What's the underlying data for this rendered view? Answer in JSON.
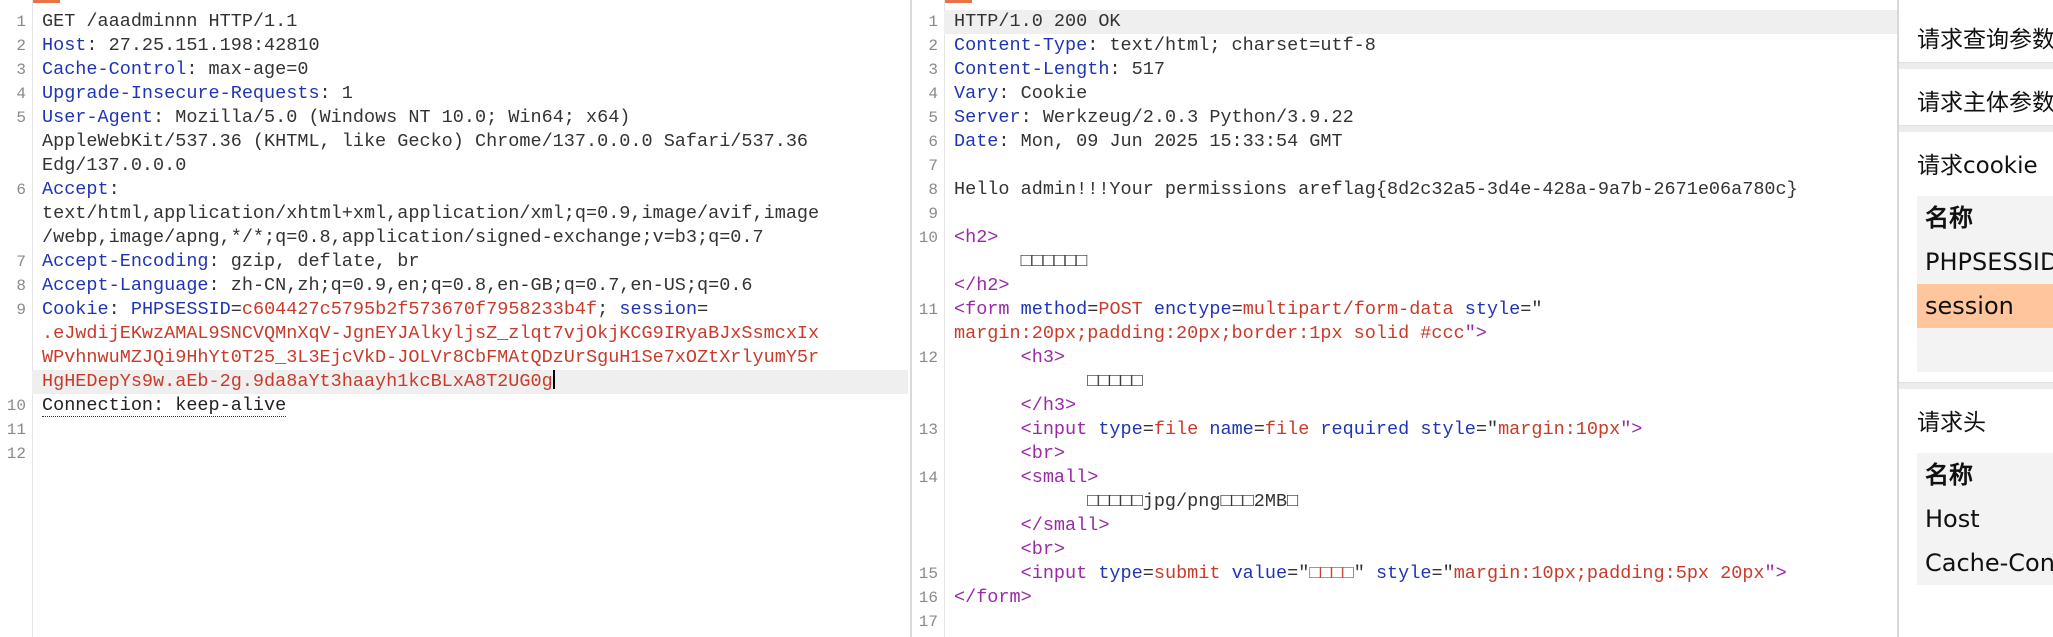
{
  "request": {
    "lines": [
      {
        "n": "1",
        "segs": [
          {
            "t": "GET /aaadminnn HTTP/1.1",
            "c": "v"
          }
        ]
      },
      {
        "n": "2",
        "segs": [
          {
            "t": "Host",
            "c": "k"
          },
          {
            "t": ": 27.25.151.198:42810",
            "c": "v"
          }
        ]
      },
      {
        "n": "3",
        "segs": [
          {
            "t": "Cache-Control",
            "c": "k"
          },
          {
            "t": ": max-age=0",
            "c": "v"
          }
        ]
      },
      {
        "n": "4",
        "segs": [
          {
            "t": "Upgrade-Insecure-Requests",
            "c": "k"
          },
          {
            "t": ": 1",
            "c": "v"
          }
        ]
      },
      {
        "n": "5",
        "segs": [
          {
            "t": "User-Agent",
            "c": "k"
          },
          {
            "t": ": Mozilla/5.0 (Windows NT 10.0; Win64; x64)",
            "c": "v"
          }
        ]
      },
      {
        "n": "",
        "segs": [
          {
            "t": "AppleWebKit/537.36 (KHTML, like Gecko) Chrome/137.0.0.0 Safari/537.36",
            "c": "v"
          }
        ]
      },
      {
        "n": "",
        "segs": [
          {
            "t": "Edg/137.0.0.0",
            "c": "v"
          }
        ]
      },
      {
        "n": "6",
        "segs": [
          {
            "t": "Accept",
            "c": "k"
          },
          {
            "t": ":",
            "c": "v"
          }
        ]
      },
      {
        "n": "",
        "segs": [
          {
            "t": "text/html,application/xhtml+xml,application/xml;q=0.9,image/avif,image",
            "c": "v"
          }
        ]
      },
      {
        "n": "",
        "segs": [
          {
            "t": "/webp,image/apng,*/*;q=0.8,application/signed-exchange;v=b3;q=0.7",
            "c": "v"
          }
        ]
      },
      {
        "n": "7",
        "segs": [
          {
            "t": "Accept-Encoding",
            "c": "k"
          },
          {
            "t": ": gzip, deflate, br",
            "c": "v"
          }
        ]
      },
      {
        "n": "8",
        "segs": [
          {
            "t": "Accept-Language",
            "c": "k"
          },
          {
            "t": ": zh-CN,zh;q=0.9,en;q=0.8,en-GB;q=0.7,en-US;q=0.6",
            "c": "v"
          }
        ]
      },
      {
        "n": "9",
        "segs": [
          {
            "t": "Cookie",
            "c": "k"
          },
          {
            "t": ": ",
            "c": "v"
          },
          {
            "t": "PHPSESSID",
            "c": "k"
          },
          {
            "t": "=",
            "c": "v"
          },
          {
            "t": "c604427c5795b2f573670f7958233b4f",
            "c": "red"
          },
          {
            "t": "; ",
            "c": "v"
          },
          {
            "t": "session",
            "c": "k"
          },
          {
            "t": "=",
            "c": "v"
          }
        ]
      },
      {
        "n": "",
        "segs": [
          {
            "t": ".eJwdijEKwzAMAL9SNCVQMnXqV-JgnEYJAlkyljsZ_zlqt7vjOkjKCG9IRyaBJxSsmcxIx",
            "c": "red"
          }
        ]
      },
      {
        "n": "",
        "segs": [
          {
            "t": "WPvhnwuMZJQi9HhYt0T25_3L3EjcVkD-JOLVr8CbFMAtQDzUrSguH1Se7xOZtXrlyumY5r",
            "c": "red"
          }
        ]
      },
      {
        "n": "",
        "hl": true,
        "cursor": true,
        "segs": [
          {
            "t": "HgHEDepYs9w.aEb-2g.9da8aYt3haayh1kcBLxA8T2UG0g",
            "c": "red"
          }
        ]
      },
      {
        "n": "10",
        "segs": [
          {
            "t": "Connection: keep-alive",
            "c": "conn"
          }
        ]
      },
      {
        "n": "11",
        "segs": []
      },
      {
        "n": "12",
        "segs": []
      }
    ]
  },
  "response": {
    "lines": [
      {
        "n": "1",
        "hl": true,
        "segs": [
          {
            "t": "HTTP/1.0 200 OK",
            "c": "v"
          }
        ]
      },
      {
        "n": "2",
        "segs": [
          {
            "t": "Content-Type",
            "c": "k"
          },
          {
            "t": ": text/html; charset=utf-8",
            "c": "v"
          }
        ]
      },
      {
        "n": "3",
        "segs": [
          {
            "t": "Content-Length",
            "c": "k"
          },
          {
            "t": ": 517",
            "c": "v"
          }
        ]
      },
      {
        "n": "4",
        "segs": [
          {
            "t": "Vary",
            "c": "k"
          },
          {
            "t": ": Cookie",
            "c": "v"
          }
        ]
      },
      {
        "n": "5",
        "segs": [
          {
            "t": "Server",
            "c": "k"
          },
          {
            "t": ": Werkzeug/2.0.3 Python/3.9.22",
            "c": "v"
          }
        ]
      },
      {
        "n": "6",
        "segs": [
          {
            "t": "Date",
            "c": "k"
          },
          {
            "t": ": Mon, 09 Jun 2025 15:33:54 GMT",
            "c": "v"
          }
        ]
      },
      {
        "n": "7",
        "segs": []
      },
      {
        "n": "8",
        "segs": [
          {
            "t": "Hello admin!!!Your permissions areflag{8d2c32a5-3d4e-428a-9a7b-2671e06a780c}",
            "c": "v"
          }
        ]
      },
      {
        "n": "9",
        "segs": []
      },
      {
        "n": "10",
        "segs": [
          {
            "t": "<h2>",
            "c": "tag"
          }
        ]
      },
      {
        "n": "",
        "segs": [
          {
            "t": "      □□□□□□",
            "c": "v"
          }
        ]
      },
      {
        "n": "",
        "segs": [
          {
            "t": "</h2>",
            "c": "tag"
          }
        ]
      },
      {
        "n": "11",
        "segs": [
          {
            "t": "<form ",
            "c": "tag"
          },
          {
            "t": "method",
            "c": "attr"
          },
          {
            "t": "=",
            "c": "v"
          },
          {
            "t": "POST ",
            "c": "str"
          },
          {
            "t": "enctype",
            "c": "attr"
          },
          {
            "t": "=",
            "c": "v"
          },
          {
            "t": "multipart/form-data ",
            "c": "str"
          },
          {
            "t": "style",
            "c": "attr"
          },
          {
            "t": "=\"",
            "c": "v"
          }
        ]
      },
      {
        "n": "",
        "segs": [
          {
            "t": "margin:20px;padding:20px;border:1px solid #ccc",
            "c": "str"
          },
          {
            "t": "\">",
            "c": "tag"
          }
        ]
      },
      {
        "n": "12",
        "segs": [
          {
            "t": "      <h3>",
            "c": "tag"
          }
        ]
      },
      {
        "n": "",
        "segs": [
          {
            "t": "            □□□□□",
            "c": "v"
          }
        ]
      },
      {
        "n": "",
        "segs": [
          {
            "t": "      </h3>",
            "c": "tag"
          }
        ]
      },
      {
        "n": "13",
        "segs": [
          {
            "t": "      <input ",
            "c": "tag"
          },
          {
            "t": "type",
            "c": "attr"
          },
          {
            "t": "=",
            "c": "v"
          },
          {
            "t": "file ",
            "c": "str"
          },
          {
            "t": "name",
            "c": "attr"
          },
          {
            "t": "=",
            "c": "v"
          },
          {
            "t": "file ",
            "c": "str"
          },
          {
            "t": "required ",
            "c": "attr"
          },
          {
            "t": "style",
            "c": "attr"
          },
          {
            "t": "=\"",
            "c": "v"
          },
          {
            "t": "margin:10px",
            "c": "str"
          },
          {
            "t": "\">",
            "c": "tag"
          }
        ]
      },
      {
        "n": "",
        "segs": [
          {
            "t": "      <br>",
            "c": "tag"
          }
        ]
      },
      {
        "n": "14",
        "segs": [
          {
            "t": "      <small>",
            "c": "tag"
          }
        ]
      },
      {
        "n": "",
        "segs": [
          {
            "t": "            □□□□□jpg/png□□□2MB□",
            "c": "v"
          }
        ]
      },
      {
        "n": "",
        "segs": [
          {
            "t": "      </small>",
            "c": "tag"
          }
        ]
      },
      {
        "n": "",
        "segs": [
          {
            "t": "      <br>",
            "c": "tag"
          }
        ]
      },
      {
        "n": "15",
        "segs": [
          {
            "t": "      <input ",
            "c": "tag"
          },
          {
            "t": "type",
            "c": "attr"
          },
          {
            "t": "=",
            "c": "v"
          },
          {
            "t": "submit ",
            "c": "str"
          },
          {
            "t": "value",
            "c": "attr"
          },
          {
            "t": "=\"",
            "c": "v"
          },
          {
            "t": "□□□□",
            "c": "str"
          },
          {
            "t": "\" ",
            "c": "v"
          },
          {
            "t": "style",
            "c": "attr"
          },
          {
            "t": "=\"",
            "c": "v"
          },
          {
            "t": "margin:10px;padding:5px 20px",
            "c": "str"
          },
          {
            "t": "\">",
            "c": "tag"
          }
        ]
      },
      {
        "n": "16",
        "segs": [
          {
            "t": "</form>",
            "c": "tag"
          }
        ]
      },
      {
        "n": "17",
        "segs": []
      }
    ]
  },
  "inspector": {
    "query_params": "请求查询参数",
    "body_params": "请求主体参数",
    "cookies_title": "请求cookie",
    "cookies_header": "名称",
    "cookies": [
      "PHPSESSID",
      "session",
      ""
    ],
    "headers_title": "请求头",
    "headers_header": "名称",
    "headers": [
      "Host",
      "Cache-Control"
    ]
  }
}
